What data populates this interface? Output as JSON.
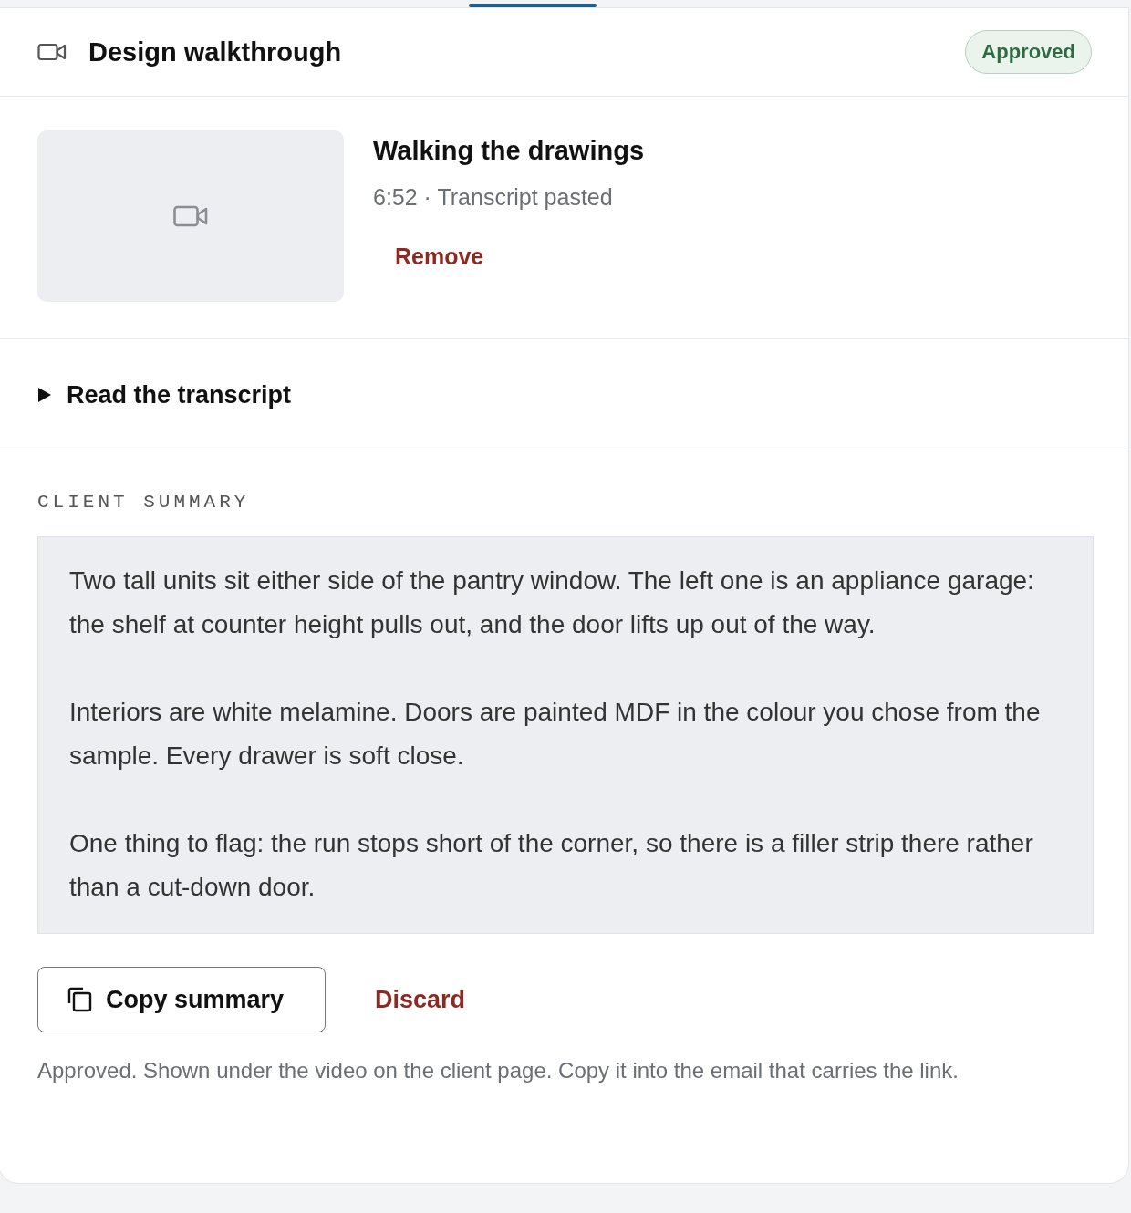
{
  "header": {
    "title": "Design walkthrough",
    "status": "Approved"
  },
  "video": {
    "title": "Walking the drawings",
    "meta": "6:52 · Transcript pasted",
    "remove_label": "Remove"
  },
  "transcript": {
    "label": "Read the transcript",
    "expanded": false
  },
  "summary": {
    "heading": "CLIENT SUMMARY",
    "paragraphs": [
      "Two tall units sit either side of the pantry window. The left one is an appliance garage: the shelf at counter height pulls out, and the door lifts up out of the way.",
      "Interiors are white melamine. Doors are painted MDF in the colour you chose from the sample. Every drawer is soft close.",
      "One thing to flag: the run stops short of the corner, so there is a filler strip there rather than a cut-down door."
    ]
  },
  "actions": {
    "copy_label": "Copy summary",
    "discard_label": "Discard"
  },
  "note": "Approved. Shown under the video on the client page. Copy it into the email that carries the link."
}
